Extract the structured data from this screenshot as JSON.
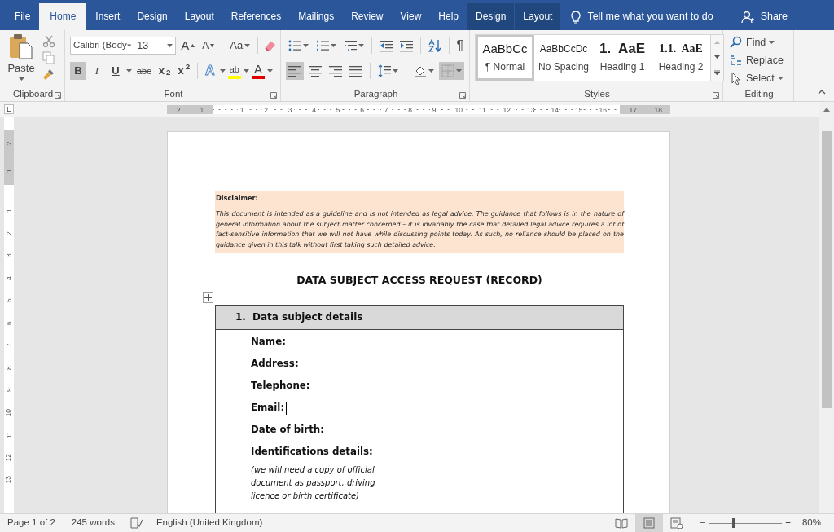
{
  "tabs": [
    {
      "label": "File",
      "selected": false,
      "contextual": false
    },
    {
      "label": "Home",
      "selected": true,
      "contextual": false
    },
    {
      "label": "Insert",
      "selected": false,
      "contextual": false
    },
    {
      "label": "Design",
      "selected": false,
      "contextual": false
    },
    {
      "label": "Layout",
      "selected": false,
      "contextual": false
    },
    {
      "label": "References",
      "selected": false,
      "contextual": false
    },
    {
      "label": "Mailings",
      "selected": false,
      "contextual": false
    },
    {
      "label": "Review",
      "selected": false,
      "contextual": false
    },
    {
      "label": "View",
      "selected": false,
      "contextual": false
    },
    {
      "label": "Help",
      "selected": false,
      "contextual": false
    },
    {
      "label": "Design",
      "selected": false,
      "contextual": true
    },
    {
      "label": "Layout",
      "selected": false,
      "contextual": true
    }
  ],
  "tell_me": "Tell me what you want to do",
  "share": "Share",
  "ribbon": {
    "clipboard": {
      "paste": "Paste",
      "label": "Clipboard"
    },
    "font": {
      "label": "Font",
      "font_name": "Calibri (Body",
      "font_size": "13",
      "grow": "A",
      "shrink": "A",
      "change_case": "Aa",
      "format_buttons": [
        {
          "label": "B",
          "kind": "bold",
          "selected": true
        },
        {
          "label": "I",
          "kind": "italic",
          "selected": false
        },
        {
          "label": "U",
          "kind": "underline",
          "selected": false
        },
        {
          "label": "abc",
          "kind": "strike",
          "selected": false
        },
        {
          "label": "x$_{2}$",
          "kind": "sub",
          "selected": false
        },
        {
          "label": "x$^{2}$",
          "kind": "sup",
          "selected": false
        }
      ],
      "effects": "A",
      "highlight": "ab",
      "font_color": "A"
    },
    "paragraph": {
      "label": "Paragraph",
      "show_marks": "¶",
      "alignments": [
        {
          "kind": "left",
          "selected": true
        },
        {
          "kind": "center",
          "selected": false
        },
        {
          "kind": "right",
          "selected": false
        },
        {
          "kind": "justify",
          "selected": false
        }
      ],
      "borders_selected": true
    },
    "styles": {
      "label": "Styles",
      "items": [
        {
          "preview": "AaBbCc",
          "name": "¶ Normal",
          "kind": "normal",
          "selected": true
        },
        {
          "preview": "AaBbCcDc",
          "name": "No Spacing",
          "kind": "nospacing",
          "selected": false
        },
        {
          "preview": "1.  AaE",
          "name": "Heading 1",
          "kind": "h1",
          "selected": false
        },
        {
          "preview": "1.1.  AaE",
          "name": "Heading 2",
          "kind": "h2",
          "selected": false
        }
      ]
    },
    "editing": {
      "label": "Editing",
      "items": [
        {
          "label": "Find",
          "kind": "find"
        },
        {
          "label": "Replace",
          "kind": "replace"
        },
        {
          "label": "Select",
          "kind": "select"
        }
      ]
    }
  },
  "ruler": {
    "horizontal": [
      "2",
      "1",
      "1",
      "2",
      "3",
      "4",
      "5",
      "6",
      "7",
      "8",
      "9",
      "10",
      "11",
      "12",
      "13",
      "14",
      "15",
      "16",
      "17",
      "18"
    ],
    "vertical": [
      "2",
      "1",
      "1",
      "2",
      "3",
      "4",
      "5",
      "6",
      "7",
      "8",
      "9",
      "10",
      "11",
      "12",
      "13"
    ]
  },
  "document": {
    "disclaimer": {
      "heading": "Disclaimer:",
      "text": "This document is intended as a guideline and is not intended as legal advice. The guidance that follows is in the nature of general information about the subject matter concerned – it is invariably the case that detailed legal advice requires a lot of fact-sensitive information that we will not have while discussing points today. As such, no reliance should be placed on the guidance given in this talk without first taking such detailed advice."
    },
    "title": "DATA SUBJECT ACCESS REQUEST (RECORD)",
    "table": {
      "section_number": "1.",
      "section_title": "Data subject details",
      "fields": [
        {
          "label": "Name:",
          "cursor": false
        },
        {
          "label": "Address:",
          "cursor": false
        },
        {
          "label": "Telephone:",
          "cursor": false
        },
        {
          "label": "Email:",
          "cursor": true
        },
        {
          "label": "Date of birth:",
          "cursor": false
        },
        {
          "label": "Identifications details:",
          "cursor": false
        }
      ],
      "note": "(we will need a copy of official document as passport, driving licence or birth certificate)"
    }
  },
  "status_bar": {
    "page": "Page 1 of 2",
    "words": "245 words",
    "language": "English (United Kingdom)",
    "views": [
      {
        "kind": "read",
        "selected": false
      },
      {
        "kind": "print",
        "selected": true
      },
      {
        "kind": "web",
        "selected": false
      }
    ],
    "zoom_out": "−",
    "zoom_in": "+",
    "zoom": {
      "level": 0.34
    },
    "zoom_percent": "80%"
  }
}
